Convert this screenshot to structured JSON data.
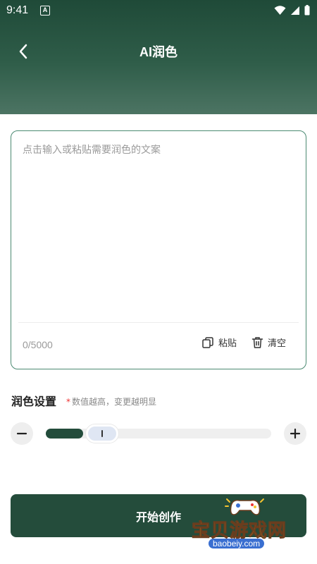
{
  "status_bar": {
    "time": "9:41",
    "notification_icon": "A"
  },
  "header": {
    "title": "AI润色",
    "back_icon": "chevron-left-icon"
  },
  "editor": {
    "placeholder": "点击输入或粘贴需要润色的文案",
    "char_count": "0/5000",
    "paste_label": "粘贴",
    "clear_label": "清空"
  },
  "settings": {
    "label": "润色设置",
    "hint_star": "*",
    "hint": "数值越高，变更越明显",
    "level": 0.25
  },
  "actions": {
    "start_label": "开始创作"
  },
  "watermark": {
    "text": "宝贝游戏网",
    "url": "baobeiy.com"
  },
  "colors": {
    "header_top": "#1f4a38",
    "accent": "#244c3b",
    "editor_border": "#4b8a72",
    "hint_star": "#ee3333"
  }
}
